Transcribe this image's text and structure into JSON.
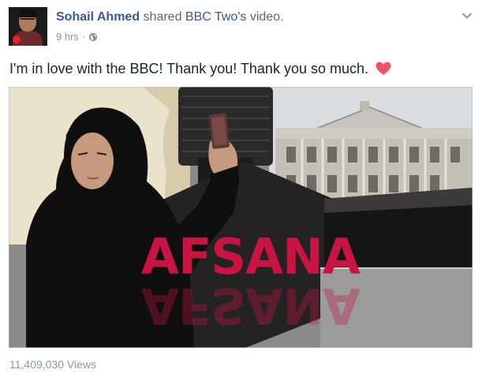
{
  "post": {
    "author": "Sohail Ahmed",
    "shared_text": "shared",
    "shared_link": "BBC Two's",
    "shared_suffix": "video.",
    "time": "9 hrs",
    "separator": "·",
    "privacy_icon": "globe-icon",
    "menu_icon": "chevron-down-icon",
    "message": "I'm in love with the BBC! Thank you! Thank you so much.",
    "message_emoji": "heart-icon"
  },
  "video": {
    "title_art": "AFSANA"
  },
  "stats": {
    "views": "11,409,030 Views"
  },
  "colors": {
    "link": "#365899",
    "meta": "#90949c",
    "heart": "#f25268",
    "title_art": "#c81443"
  }
}
